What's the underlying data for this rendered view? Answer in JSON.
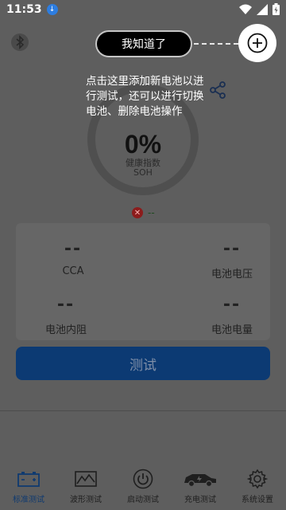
{
  "status_bar": {
    "time": "11:53"
  },
  "guide": {
    "pill_label": "我知道了",
    "text": "点击这里添加新电池以进行测试，还可以进行切换电池、删除电池操作"
  },
  "gauge": {
    "percent": "0%",
    "label_cn": "健康指数",
    "label_en": "SOH",
    "value": 0
  },
  "status_line": "--",
  "metrics": [
    {
      "value": "--",
      "label": "CCA"
    },
    {
      "value": "--",
      "label": "电池电压"
    },
    {
      "value": "--",
      "label": "电池内阻"
    },
    {
      "value": "--",
      "label": "电池电量"
    }
  ],
  "test_button": {
    "label": "测试"
  },
  "bottom_nav": [
    {
      "label": "标准测试",
      "icon": "battery-icon",
      "active": true
    },
    {
      "label": "波形测试",
      "icon": "waveform-icon",
      "active": false
    },
    {
      "label": "启动测试",
      "icon": "power-icon",
      "active": false
    },
    {
      "label": "充电测试",
      "icon": "car-charge-icon",
      "active": false
    },
    {
      "label": "系统设置",
      "icon": "gear-icon",
      "active": false
    }
  ],
  "colors": {
    "overlay_bg": "#5e5e5e",
    "accent": "#0c3a73",
    "error": "#8c1c1c"
  }
}
